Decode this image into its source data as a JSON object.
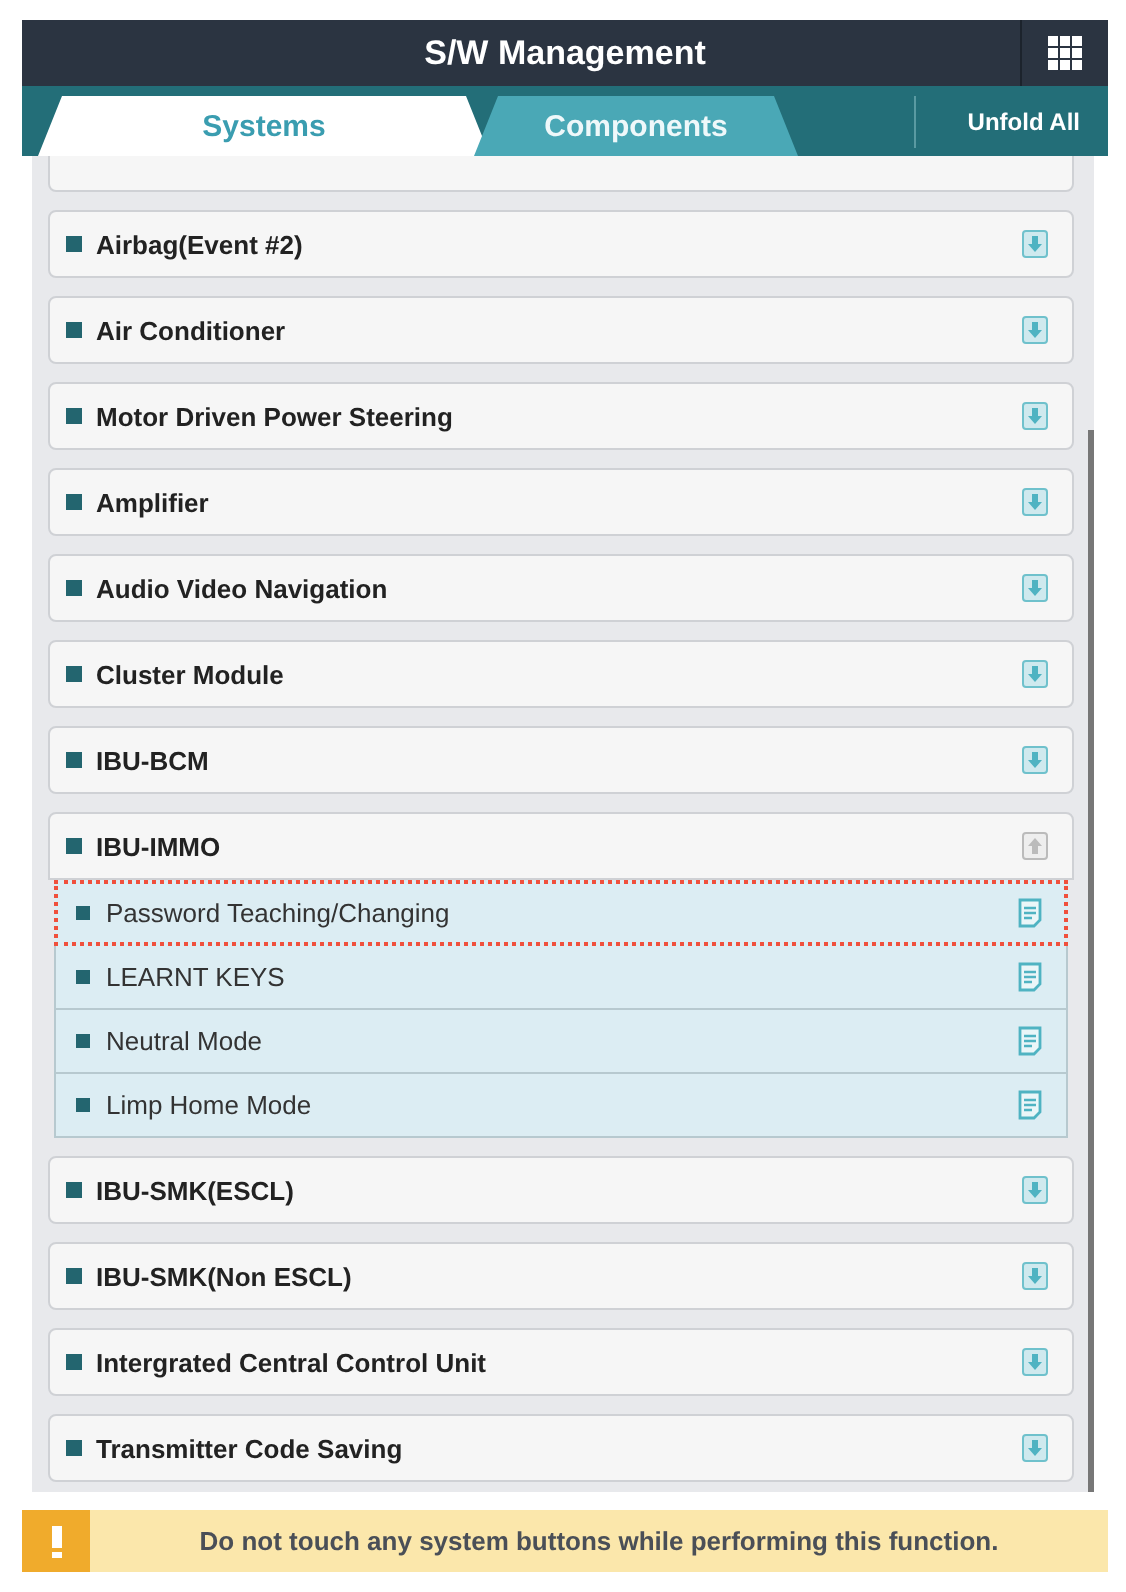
{
  "header": {
    "title": "S/W Management"
  },
  "tabs": [
    {
      "label": "Systems",
      "selected": true
    },
    {
      "label": "Components",
      "selected": false
    }
  ],
  "unfold_all": "Unfold All",
  "systems": [
    {
      "name": "Airbag(Event #2)",
      "expanded": false
    },
    {
      "name": "Air Conditioner",
      "expanded": false
    },
    {
      "name": "Motor Driven Power Steering",
      "expanded": false
    },
    {
      "name": "Amplifier",
      "expanded": false
    },
    {
      "name": "Audio Video Navigation",
      "expanded": false
    },
    {
      "name": "Cluster Module",
      "expanded": false
    },
    {
      "name": "IBU-BCM",
      "expanded": false
    },
    {
      "name": "IBU-IMMO",
      "expanded": true,
      "children": [
        {
          "name": "Password Teaching/Changing",
          "selected": true
        },
        {
          "name": "LEARNT KEYS",
          "selected": false
        },
        {
          "name": "Neutral Mode",
          "selected": false
        },
        {
          "name": "Limp Home Mode",
          "selected": false
        }
      ]
    },
    {
      "name": "IBU-SMK(ESCL)",
      "expanded": false
    },
    {
      "name": "IBU-SMK(Non ESCL)",
      "expanded": false
    },
    {
      "name": "Intergrated Central Control Unit",
      "expanded": false
    },
    {
      "name": "Transmitter Code Saving",
      "expanded": false
    }
  ],
  "warning": "Do not touch any system buttons while performing this function."
}
